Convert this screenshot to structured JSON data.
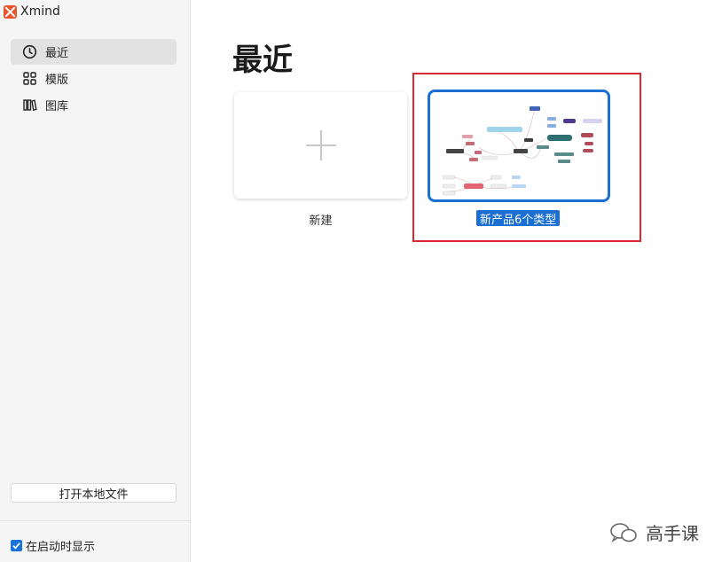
{
  "app": {
    "name": "Xmind"
  },
  "sidebar": {
    "items": [
      {
        "label": "最近",
        "icon": "clock-icon",
        "active": true
      },
      {
        "label": "模版",
        "icon": "template-grid-icon",
        "active": false
      },
      {
        "label": "图库",
        "icon": "library-icon",
        "active": false
      }
    ],
    "open_local_label": "打开本地文件",
    "show_on_startup": {
      "label": "在启动时显示",
      "checked": true
    }
  },
  "main": {
    "title": "最近",
    "new_card": {
      "label": "新建"
    },
    "files": [
      {
        "name": "新产品6个类型"
      }
    ]
  },
  "watermark": {
    "text": "高手课"
  },
  "colors": {
    "accent": "#1b6fd3",
    "annotation_box": "#d9282f",
    "logo": "#e8542e"
  }
}
